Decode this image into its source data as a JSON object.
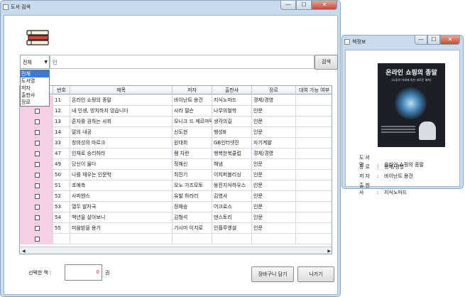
{
  "main_window": {
    "title": "도서 검색",
    "window_buttons": {
      "minimize": "—",
      "maximize": "☐",
      "close": "✕"
    },
    "search": {
      "category_selected": "전체",
      "category_options": [
        "전체",
        "도서명",
        "저자",
        "출판사",
        "장르"
      ],
      "query": "인",
      "button_label": "검색"
    },
    "table": {
      "headers": [
        "",
        "번호",
        "제목",
        "저자",
        "출판사",
        "장르",
        "대여 가능 여부"
      ],
      "rows": [
        {
          "no": "11",
          "title": "온라인 쇼핑의 종말",
          "author": "바이난트 용건",
          "publisher": "지식노마드",
          "genre": "경제/경영",
          "available": ""
        },
        {
          "no": "12",
          "title": "내 인생, 방치하지 않습니다",
          "author": "사라 필슨",
          "publisher": "나무의철학",
          "genre": "인문",
          "available": ""
        },
        {
          "no": "13",
          "title": "혼자를 권하는 사회",
          "author": "모니크 드 케르마덱",
          "publisher": "생각의길",
          "genre": "인문",
          "available": ""
        },
        {
          "no": "14",
          "title": "말의 내공",
          "author": "신도현",
          "publisher": "행성B",
          "genre": "인문",
          "available": ""
        },
        {
          "no": "33",
          "title": "창의성의 마르크",
          "author": "원대희",
          "publisher": "GB인터넷진",
          "genre": "자기계발",
          "available": ""
        },
        {
          "no": "47",
          "title": "인재로 승리하라",
          "author": "램 차란",
          "publisher": "행복한북클럽",
          "genre": "경제/경영",
          "available": ""
        },
        {
          "no": "49",
          "title": "당신이 옳다",
          "author": "정혜신",
          "publisher": "해냄",
          "genre": "인문",
          "available": ""
        },
        {
          "no": "50",
          "title": "나를 채우는 인문학",
          "author": "최진기",
          "publisher": "이지퍼블리싱",
          "genre": "인문",
          "available": ""
        },
        {
          "no": "51",
          "title": "초예측",
          "author": "오노 가즈모토",
          "publisher": "웅진지식하우스",
          "genre": "인문",
          "available": ""
        },
        {
          "no": "52",
          "title": "사피엔스",
          "author": "유발 하라리",
          "publisher": "김영사",
          "genre": "인문",
          "available": ""
        },
        {
          "no": "53",
          "title": "열두 발자국",
          "author": "정재승",
          "publisher": "어크로스",
          "genre": "인문",
          "available": ""
        },
        {
          "no": "54",
          "title": "백년을 살아보니",
          "author": "김형석",
          "publisher": "덴스토리",
          "genre": "인문",
          "available": ""
        },
        {
          "no": "55",
          "title": "미움받을 용기",
          "author": "기시미 이치로",
          "publisher": "인플루엔셜",
          "genre": "인문",
          "available": ""
        }
      ],
      "empty_rows": 1
    },
    "footer": {
      "selected_label": "선택한 책 :",
      "selected_count": "0",
      "unit": "권",
      "cart_button": "장바구니 담기",
      "exit_button": "나가기"
    }
  },
  "info_window": {
    "title": "책정보",
    "window_buttons": {
      "minimize": "—",
      "maximize": "☐",
      "close": "✕"
    },
    "cover": {
      "title": "온라인 쇼핑의 종말",
      "subtitle": "(쇼핑의 미래에 대한 새로운 예측)"
    },
    "fields": [
      {
        "key": "도서명",
        "value": "온라인 쇼핑의 종말"
      },
      {
        "key": "장르",
        "value": "경제/경영"
      },
      {
        "key": "저자",
        "value": "바이난트 용건"
      },
      {
        "key": "출판사",
        "value": "지식노마드"
      }
    ]
  },
  "colors": {
    "window_frame": "#c8dbef",
    "checkbox_column": "#f3cfe3",
    "count_text": "#d1281f",
    "dropdown_selected": "#3a7bd5"
  }
}
